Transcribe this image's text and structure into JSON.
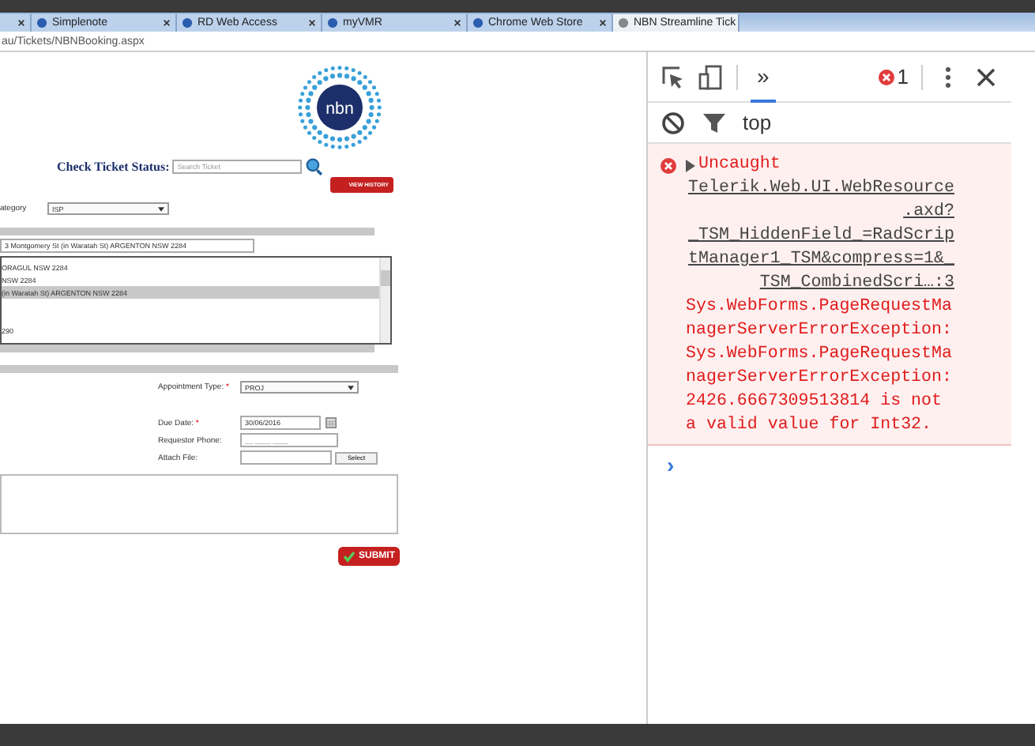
{
  "browser": {
    "tabs": [
      {
        "selected": false
      },
      {
        "label": "Simplenote",
        "selected": false
      },
      {
        "label": "RD Web Access",
        "selected": false
      },
      {
        "label": "myVMR",
        "selected": false
      },
      {
        "label": "Chrome Web Store",
        "selected": false
      },
      {
        "label": "NBN Streamline Tick",
        "selected": true
      }
    ],
    "address": "au/Tickets/NBNBooking.aspx"
  },
  "page": {
    "logo": "nbn",
    "check_status": {
      "label": "Check Ticket Status:",
      "placeholder": "Search Ticket"
    },
    "view_history": "VIEW HISTORY",
    "category": {
      "label": "ategory",
      "value": "ISP"
    },
    "address_value": "3 Montgomery St (in Waratah St) ARGENTON NSW 2284",
    "address_list": [
      {
        "text": "ORAGUL NSW 2284",
        "selected": false
      },
      {
        "text": "NSW 2284",
        "selected": false
      },
      {
        "text": "(in Waratah St) ARGENTON NSW 2284",
        "selected": true
      },
      {
        "text": "290",
        "selected": false
      }
    ],
    "appointment": {
      "label": "Appointment Type:",
      "required_mark": "*",
      "value": "PROJ"
    },
    "due_date": {
      "label": "Due Date:",
      "required_mark": "*",
      "value": "30/06/2016"
    },
    "phone": {
      "label": "Requestor Phone:",
      "placeholder": "__ ____ ____"
    },
    "attach": {
      "label": "Attach File:",
      "button": "Select"
    },
    "submit": "SUBMIT"
  },
  "devtools": {
    "tabs": [
      {
        "label": "»",
        "selected": true
      }
    ],
    "error_count": "1",
    "context": "top",
    "messages": [
      {
        "kind": "error",
        "title": "Uncaught",
        "source": "Telerik.Web.UI.WebResource.axd?_TSM_HiddenField_=RadScriptManager1_TSM&compress=1&_TSM_CombinedScri…:3",
        "text": "Sys.WebForms.PageRequestManagerServerErrorException: Sys.WebForms.PageRequestManagerServerErrorException: 2426.6667309513814 is not a valid value for Int32."
      }
    ],
    "prompt": "›"
  }
}
